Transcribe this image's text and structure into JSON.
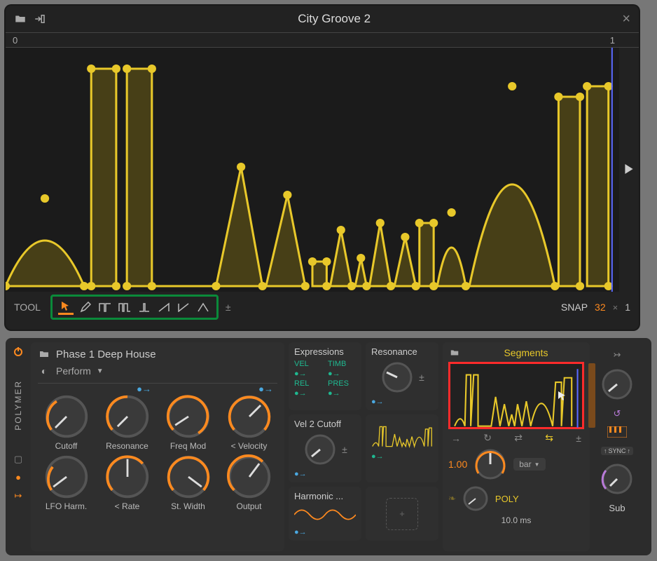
{
  "editor": {
    "title": "City Groove 2",
    "ruler_start": "0",
    "ruler_end": "1",
    "tool_label": "TOOL",
    "pm": "±",
    "snap_label": "SNAP",
    "snap_divisions": "32",
    "snap_times": "×",
    "snap_mult": "1",
    "tools": [
      "pointer",
      "pencil",
      "step",
      "pulse",
      "half",
      "ramp-up",
      "ramp-down",
      "triangle"
    ]
  },
  "polymer": {
    "device_label": "POLYMER",
    "preset_folder": "Phase 1 Deep House",
    "preset_menu": "Perform",
    "knobs": [
      {
        "label": "Cutoff"
      },
      {
        "label": "Resonance"
      },
      {
        "label": "Freq Mod"
      },
      {
        "label": "< Velocity"
      },
      {
        "label": "LFO Harm."
      },
      {
        "label": "< Rate"
      },
      {
        "label": "St. Width"
      },
      {
        "label": "Output"
      }
    ]
  },
  "expressions": {
    "title": "Expressions",
    "items": [
      "VEL",
      "TIMB",
      "REL",
      "PRES"
    ]
  },
  "resonance": {
    "title": "Resonance"
  },
  "vel2": {
    "title": "Vel 2 Cutoff"
  },
  "harmonic": {
    "title": "Harmonic ..."
  },
  "segments": {
    "title": "Segments",
    "rate_value": "1.00",
    "rate_unit": "bar",
    "smoothing": "10.0 ms",
    "mode": "POLY"
  },
  "right": {
    "sync": "SYNC",
    "sub": "Sub"
  },
  "colors": {
    "orange": "#ff8a1f",
    "yellow": "#e8c82a",
    "green": "#1fb890",
    "blue": "#4aa8e0",
    "red": "#ff2b2b"
  }
}
